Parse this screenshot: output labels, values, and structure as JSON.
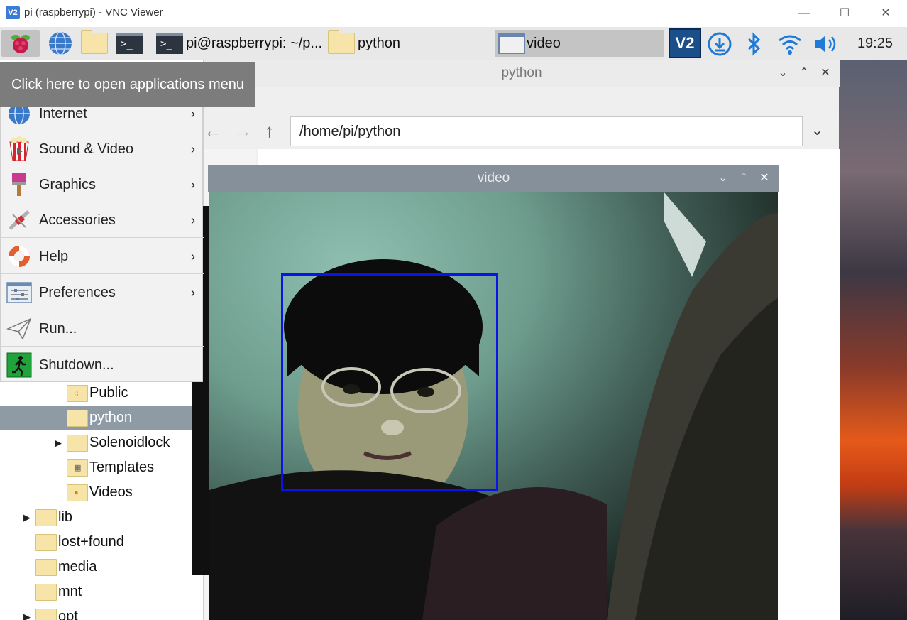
{
  "vnc": {
    "logo": "V2",
    "title": "pi (raspberrypi) - VNC Viewer",
    "minimize": "—",
    "maximize": "☐",
    "close": "✕"
  },
  "panel": {
    "tasks": [
      {
        "label": "pi@raspberrypi: ~/p...",
        "icon": "terminal-icon"
      },
      {
        "label": "python",
        "icon": "folder-icon"
      },
      {
        "label": "video",
        "icon": "video-window-icon"
      }
    ],
    "tray": {
      "vnc": "V2",
      "bluetooth": "✱",
      "volume": "🔊"
    },
    "clock": "19:25"
  },
  "tooltip": "Click here to open applications menu",
  "menu": {
    "items": [
      {
        "label": "Internet",
        "icon": "globe-icon",
        "submenu": true
      },
      {
        "label": "Sound & Video",
        "icon": "popcorn-icon",
        "submenu": true
      },
      {
        "label": "Graphics",
        "icon": "paintbrush-icon",
        "submenu": true
      },
      {
        "label": "Accessories",
        "icon": "knife-icon",
        "submenu": true
      },
      {
        "label": "Help",
        "icon": "lifebuoy-icon",
        "submenu": true
      },
      {
        "label": "Preferences",
        "icon": "sliders-icon",
        "submenu": true
      },
      {
        "label": "Run...",
        "icon": "paper-plane-icon",
        "submenu": false
      },
      {
        "label": "Shutdown...",
        "icon": "exit-icon",
        "submenu": false
      }
    ],
    "chevron": "›"
  },
  "file_manager": {
    "title": "python",
    "path": "/home/pi/python",
    "ctl_min": "⌄",
    "ctl_max": "⌃",
    "ctl_close": "✕",
    "tree": [
      {
        "label": "Public",
        "expander": "",
        "mini": "⁝⁝",
        "selected": false
      },
      {
        "label": "python",
        "expander": "",
        "mini": "",
        "selected": true
      },
      {
        "label": "Solenoidlock",
        "expander": "▶",
        "mini": "",
        "selected": false
      },
      {
        "label": "Templates",
        "expander": "",
        "mini": "▦",
        "selected": false
      },
      {
        "label": "Videos",
        "expander": "",
        "mini": "●",
        "selected": false
      },
      {
        "label": "lib",
        "expander": "▶",
        "mini": "",
        "selected": false
      },
      {
        "label": "lost+found",
        "expander": "",
        "mini": "",
        "selected": false
      },
      {
        "label": "media",
        "expander": "",
        "mini": "",
        "selected": false
      },
      {
        "label": "mnt",
        "expander": "",
        "mini": "",
        "selected": false
      },
      {
        "label": "opt",
        "expander": "▶",
        "mini": "",
        "selected": false
      }
    ]
  },
  "video_window": {
    "title": "video",
    "ctl_min": "⌄",
    "ctl_max": "⌃",
    "ctl_close": "✕"
  }
}
